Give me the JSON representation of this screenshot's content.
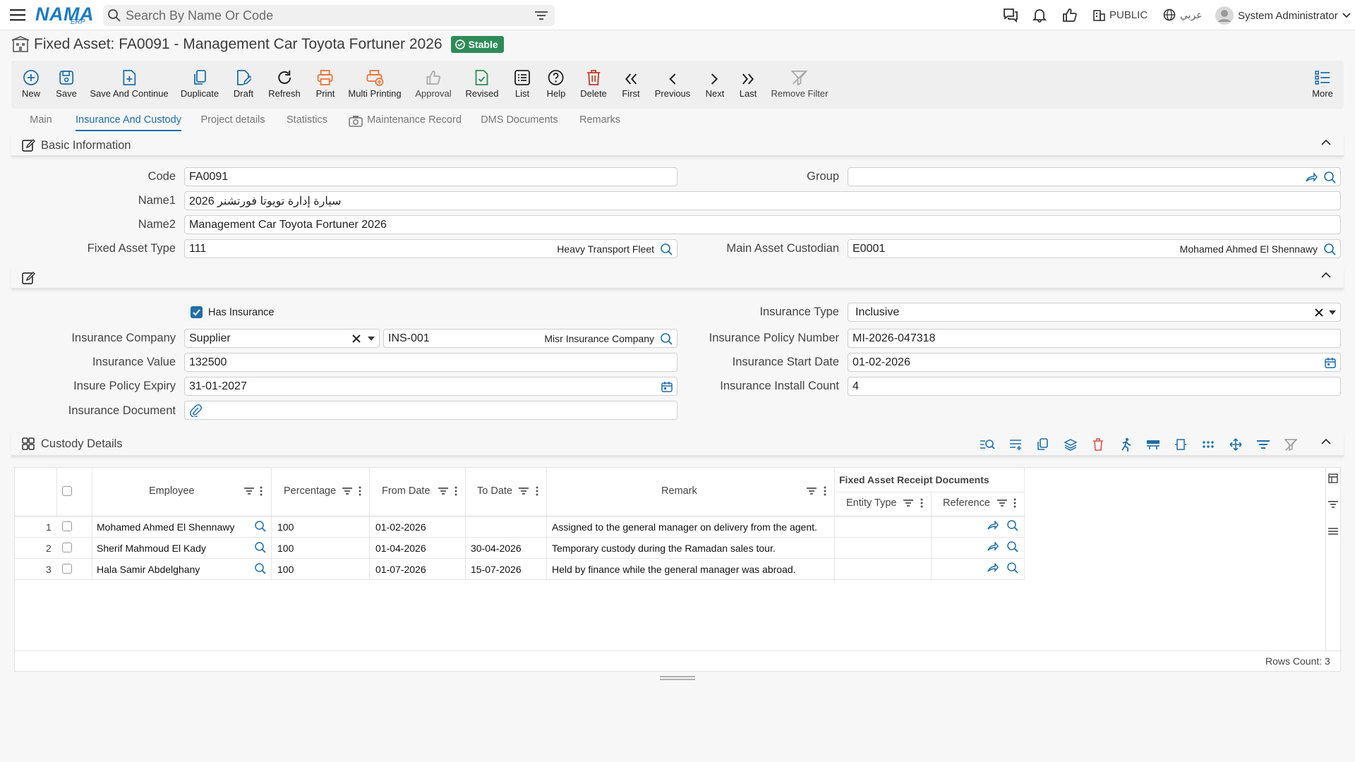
{
  "app": {
    "logo_text": "NAMA",
    "logo_sub": "ERP"
  },
  "search": {
    "placeholder": "Search By Name Or Code"
  },
  "topbar": {
    "language": "عربي",
    "scope": "PUBLIC",
    "user": "System Administrator"
  },
  "page": {
    "title": "Fixed Asset: FA0091 - Management Car Toyota Fortuner 2026",
    "status": "Stable"
  },
  "toolbar": {
    "new": "New",
    "save": "Save",
    "save_continue": "Save And Continue",
    "duplicate": "Duplicate",
    "draft": "Draft",
    "refresh": "Refresh",
    "print": "Print",
    "multi_printing": "Multi Printing",
    "approval": "Approval",
    "revised": "Revised",
    "list": "List",
    "help": "Help",
    "delete": "Delete",
    "first": "First",
    "previous": "Previous",
    "next": "Next",
    "last": "Last",
    "remove_filter": "Remove Filter",
    "more": "More"
  },
  "tabs": [
    "Main",
    "Insurance And Custody",
    "Project details",
    "Statistics",
    "Maintenance Record",
    "DMS Documents",
    "Remarks"
  ],
  "basic_info": {
    "title": "Basic Information",
    "code_label": "Code",
    "code": "FA0091",
    "group_label": "Group",
    "group": "",
    "name1_label": "Name1",
    "name1": "سيارة إدارة تويوتا فورتشنر 2026",
    "name2_label": "Name2",
    "name2": "Management Car Toyota Fortuner 2026",
    "type_label": "Fixed Asset Type",
    "type_code": "111",
    "type_name": "Heavy Transport Fleet",
    "custodian_label": "Main Asset Custodian",
    "custodian_code": "E0001",
    "custodian_name": "Mohamed Ahmed El Shennawy"
  },
  "insurance": {
    "has_insurance_label": "Has Insurance",
    "has_insurance": true,
    "type_label": "Insurance Type",
    "type": "Inclusive",
    "company_label": "Insurance Company",
    "company_kind": "Supplier",
    "company_code": "INS-001",
    "company_name": "Misr Insurance Company",
    "policy_label": "Insurance Policy Number",
    "policy": "MI-2026-047318",
    "value_label": "Insurance Value",
    "value": "132500",
    "start_label": "Insurance Start Date",
    "start": "01-02-2026",
    "expiry_label": "Insure Policy Expiry",
    "expiry": "31-01-2027",
    "install_label": "Insurance Install Count",
    "install": "4",
    "document_label": "Insurance Document"
  },
  "custody": {
    "title": "Custody Details",
    "columns": {
      "employee": "Employee",
      "percentage": "Percentage",
      "from": "From Date",
      "to": "To Date",
      "remark": "Remark",
      "group": "Fixed Asset Receipt Documents",
      "entity": "Entity Type",
      "reference": "Reference"
    },
    "rows": [
      {
        "n": "1",
        "employee": "Mohamed Ahmed El Shennawy",
        "percentage": "100",
        "from": "01-02-2026",
        "to": "",
        "remark": "Assigned to the general manager on delivery from the agent."
      },
      {
        "n": "2",
        "employee": "Sherif Mahmoud El Kady",
        "percentage": "100",
        "from": "01-04-2026",
        "to": "30-04-2026",
        "remark": "Temporary custody during the Ramadan sales tour."
      },
      {
        "n": "3",
        "employee": "Hala Samir Abdelghany",
        "percentage": "100",
        "from": "01-07-2026",
        "to": "15-07-2026",
        "remark": "Held by finance while the general manager was abroad."
      }
    ],
    "rows_count": "Rows Count: 3"
  },
  "colors": {
    "accent": "#1f6fa8",
    "stable": "#2e8b57",
    "danger": "#d9534f",
    "print": "#e8733a"
  }
}
